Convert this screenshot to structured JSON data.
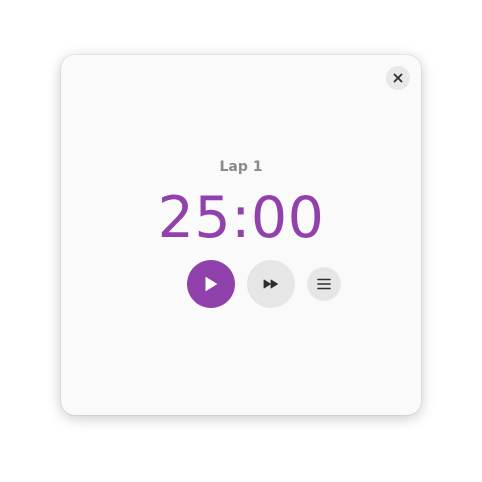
{
  "lap": {
    "label": "Lap 1"
  },
  "timer": {
    "display": "25:00"
  },
  "colors": {
    "accent": "#9141ac",
    "icon_dark": "#2e2e2e",
    "secondary_text": "#8a8a8a"
  },
  "icons": {
    "close": "close-icon",
    "play": "play-icon",
    "skip": "skip-forward-icon",
    "menu": "hamburger-menu-icon"
  }
}
